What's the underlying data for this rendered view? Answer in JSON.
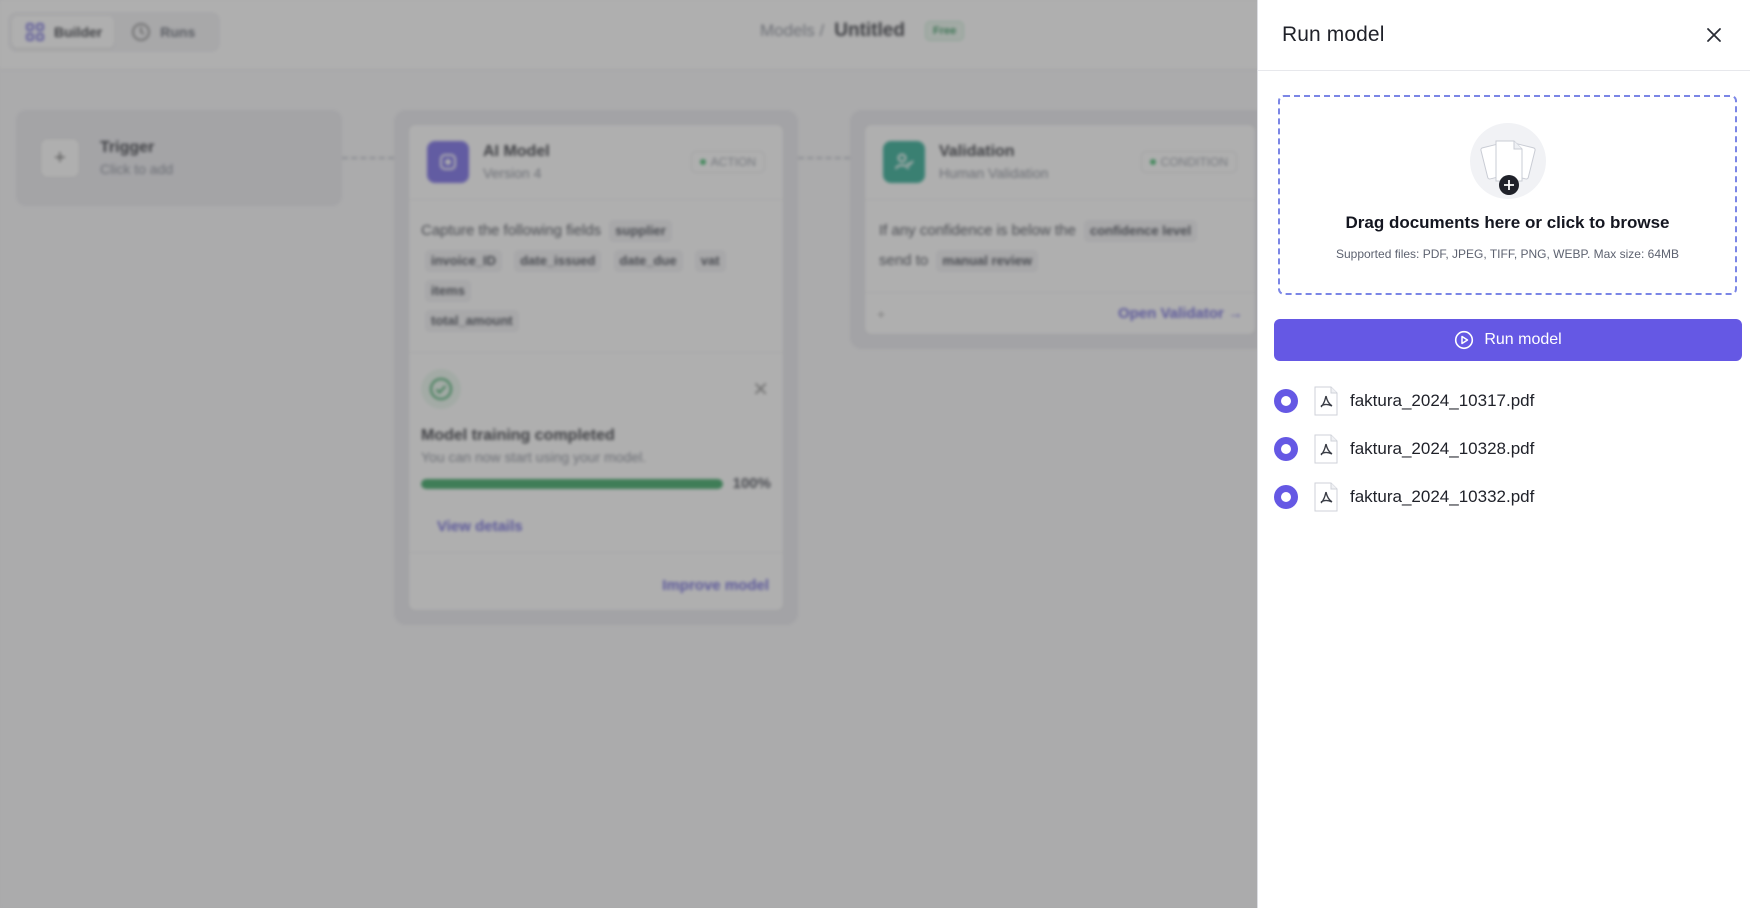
{
  "topbar": {
    "tabs": [
      {
        "label": "Builder",
        "icon": "builder-icon",
        "active": true
      },
      {
        "label": "Runs",
        "icon": "history-icon",
        "active": false
      }
    ],
    "breadcrumb_parent": "Models /",
    "title": "Untitled",
    "plan_badge": "Free"
  },
  "canvas": {
    "trigger": {
      "title": "Trigger",
      "subtitle": "Click to add"
    },
    "ai_model": {
      "title": "AI Model",
      "subtitle": "Version 4",
      "tag": "ACTION",
      "capture_text": "Capture the following fields",
      "fields": [
        "supplier",
        "invoice_ID",
        "date_issued",
        "date_due",
        "vat",
        "items",
        "total_amount"
      ],
      "training": {
        "title": "Model training completed",
        "subtitle": "You can now start using your model.",
        "progress": 100,
        "progress_label": "100%",
        "view_details": "View details"
      },
      "improve_label": "Improve model"
    },
    "validation": {
      "title": "Validation",
      "subtitle": "Human Validation",
      "tag": "CONDITION",
      "text_a": "If any confidence is below the",
      "chip_a": "confidence level",
      "text_b": "send to",
      "chip_b": "manual review",
      "open_label": "Open Validator →"
    }
  },
  "drawer": {
    "title": "Run model",
    "dropzone": {
      "title": "Drag documents here or click to browse",
      "subtitle": "Supported files: PDF, JPEG, TIFF, PNG, WEBP. Max size: 64MB"
    },
    "run_button": "Run model",
    "files": [
      {
        "name": "faktura_2024_10317.pdf",
        "selected": true
      },
      {
        "name": "faktura_2024_10328.pdf",
        "selected": true
      },
      {
        "name": "faktura_2024_10332.pdf",
        "selected": true
      }
    ]
  },
  "colors": {
    "accent": "#6558e4",
    "success": "#1e9a4e",
    "validation": "#14a085"
  }
}
